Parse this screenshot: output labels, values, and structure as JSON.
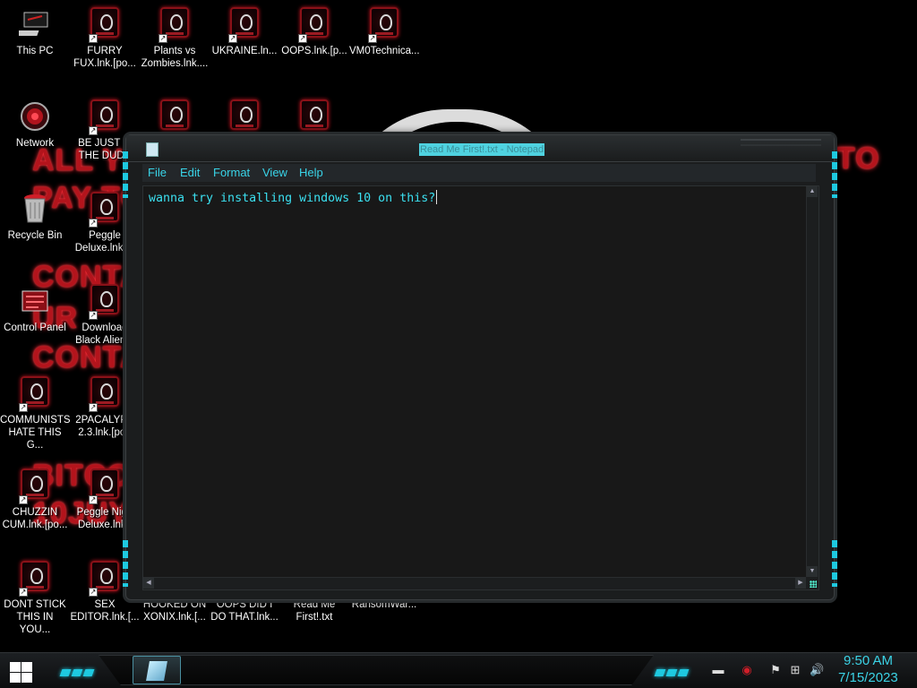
{
  "desktop": {
    "wallpaper_text": [
      "ALL YO",
      "PAY TO",
      "CONTA",
      "UR",
      "CONTA",
      "BITCOI",
      "10JUY",
      "TO"
    ],
    "icons": [
      {
        "label": "This PC",
        "type": "pc"
      },
      {
        "label": "FURRY FUX.lnk.[po...",
        "type": "alien"
      },
      {
        "label": "Plants vs Zombies.lnk....",
        "type": "alien"
      },
      {
        "label": "UKRAINE.ln...",
        "type": "alien"
      },
      {
        "label": "OOPS.lnk.[p...",
        "type": "alien"
      },
      {
        "label": "VM0Technica...",
        "type": "alien"
      },
      {
        "label": "Network",
        "type": "network"
      },
      {
        "label": "BE JUST LI THE DUDE",
        "type": "alien"
      },
      {
        "label": "",
        "type": "alien"
      },
      {
        "label": "",
        "type": "alien"
      },
      {
        "label": "",
        "type": "alien"
      },
      {
        "label": "Recycle Bin",
        "type": "bin"
      },
      {
        "label": "Peggle Deluxe.lnk.[p",
        "type": "alien"
      },
      {
        "label": "Control Panel",
        "type": "control"
      },
      {
        "label": "Download Black Alien e",
        "type": "alien"
      },
      {
        "label": "COMMUNISTS HATE THIS G...",
        "type": "alien"
      },
      {
        "label": "2PACALYPS 2.3.lnk.[poo",
        "type": "alien"
      },
      {
        "label": "CHUZZIN CUM.lnk.[po...",
        "type": "alien"
      },
      {
        "label": "Peggle Nigh Deluxe.lnk.[",
        "type": "alien"
      },
      {
        "label": "DONT STICK THIS IN YOU...",
        "type": "alien"
      },
      {
        "label": "SEX EDITOR.lnk.[...",
        "type": "alien"
      },
      {
        "label": "HOOKED ON XONIX.lnk.[...",
        "type": "none"
      },
      {
        "label": "OOPS DID I DO THAT.lnk...",
        "type": "none"
      },
      {
        "label": "Read Me First!.txt",
        "type": "none"
      },
      {
        "label": "RansomWar...",
        "type": "none"
      }
    ]
  },
  "notepad": {
    "title": "Read Me First!.txt - Notepad",
    "menu": [
      "File",
      "Edit",
      "Format",
      "View",
      "Help"
    ],
    "content": "wanna try installing windows 10 on this?",
    "accent_color": "#1ec9e0"
  },
  "taskbar": {
    "time": "9:50 AM",
    "date": "7/15/2023",
    "tray_icons": [
      "keyboard-icon",
      "alienware-icon",
      "flag-error-icon",
      "network-icon",
      "volume-icon"
    ]
  }
}
